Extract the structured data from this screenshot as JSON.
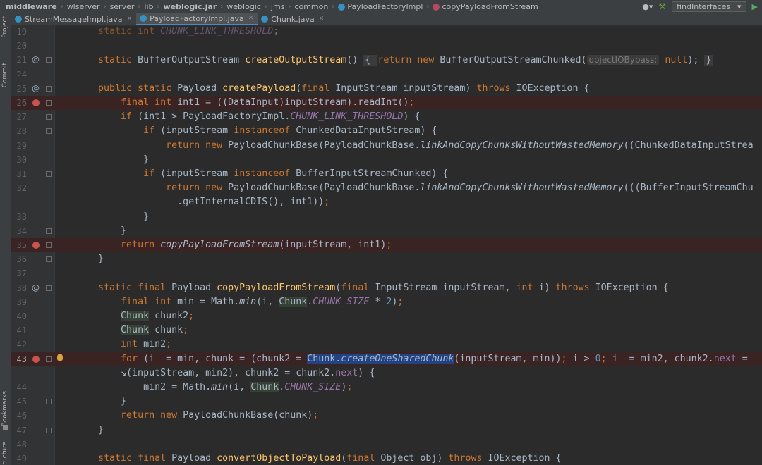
{
  "breadcrumbs": [
    {
      "label": "middleware",
      "bold": true
    },
    {
      "label": "wlserver",
      "bold": false
    },
    {
      "label": "server",
      "bold": false
    },
    {
      "label": "lib",
      "bold": false
    },
    {
      "label": "weblogic.jar",
      "bold": true
    },
    {
      "label": "weblogic",
      "bold": false
    },
    {
      "label": "jms",
      "bold": false
    },
    {
      "label": "common",
      "bold": false
    },
    {
      "label": "PayloadFactoryImpl",
      "bold": false,
      "icon": "class-c"
    },
    {
      "label": "copyPayloadFromStream",
      "bold": false,
      "icon": "method-m"
    }
  ],
  "toolbar": {
    "user_icon": "user-icon",
    "build_icon": "hammer-icon",
    "run_config_label": "findInterfaces",
    "run_icon": "run-icon"
  },
  "tabs": [
    {
      "label": "StreamMessageImpl.java",
      "active": false
    },
    {
      "label": "PayloadFactoryImpl.java",
      "active": true
    },
    {
      "label": "Chunk.java",
      "active": false
    }
  ],
  "side_tools": {
    "project": "Project",
    "commit": "Commit",
    "bookmarks": "Bookmarks",
    "structure": "Structure"
  },
  "colors": {
    "background": "#2b2b2b",
    "keyword": "#cc7832",
    "method_decl": "#ffc66d",
    "static_field": "#9876aa",
    "number": "#6897bb",
    "breakpoint": "#c75450",
    "selection": "#214283"
  },
  "lines": [
    {
      "n": "19",
      "gutter": "",
      "segments": [
        [
          "    ",
          ""
        ],
        [
          "static int ",
          "kw"
        ],
        [
          "CHUNK_LINK_THRESHOLD",
          "st"
        ],
        [
          ";",
          ""
        ]
      ],
      "faded": true
    },
    {
      "n": "20",
      "gutter": "",
      "segments": []
    },
    {
      "n": "21",
      "gutter": "@",
      "segments": [
        [
          "    ",
          ""
        ],
        [
          "static ",
          "kw"
        ],
        [
          "BufferOutputStream ",
          ""
        ],
        [
          "createOutputStream",
          "fn"
        ],
        [
          "() ",
          ""
        ],
        [
          "{ ",
          "fb"
        ],
        [
          "return new ",
          "kw"
        ],
        [
          "BufferOutputStreamChunked(",
          ""
        ],
        [
          "objectIOBypass:",
          "hint"
        ],
        [
          " ",
          ""
        ],
        [
          "null",
          "kw"
        ],
        [
          "); ",
          ""
        ],
        [
          "}",
          "fb"
        ]
      ]
    },
    {
      "n": "24",
      "gutter": "",
      "segments": []
    },
    {
      "n": "25",
      "gutter": "@",
      "segments": [
        [
          "    ",
          ""
        ],
        [
          "public static ",
          "kw"
        ],
        [
          "Payload ",
          ""
        ],
        [
          "createPayload",
          "fn"
        ],
        [
          "(",
          ""
        ],
        [
          "final ",
          "kw"
        ],
        [
          "InputStream inputStream) ",
          ""
        ],
        [
          "throws ",
          "kw"
        ],
        [
          "IOException {",
          ""
        ]
      ]
    },
    {
      "n": "26",
      "gutter": "bp",
      "segments": [
        [
          "        ",
          ""
        ],
        [
          "final int ",
          "kw"
        ],
        [
          "int1 = ((DataInput)inputStream).readInt()",
          ""
        ],
        [
          ";",
          "kw"
        ]
      ]
    },
    {
      "n": "27",
      "gutter": "",
      "segments": [
        [
          "        ",
          ""
        ],
        [
          "if ",
          "kw"
        ],
        [
          "(int1 > PayloadFactoryImpl.",
          ""
        ],
        [
          "CHUNK_LINK_THRESHOLD",
          "st"
        ],
        [
          ") {",
          ""
        ]
      ]
    },
    {
      "n": "28",
      "gutter": "",
      "segments": [
        [
          "            ",
          ""
        ],
        [
          "if ",
          "kw"
        ],
        [
          "(inputStream ",
          ""
        ],
        [
          "instanceof ",
          "kw"
        ],
        [
          "ChunkedDataInputStream) {",
          ""
        ]
      ]
    },
    {
      "n": "29",
      "gutter": "",
      "segments": [
        [
          "                ",
          ""
        ],
        [
          "return new ",
          "kw"
        ],
        [
          "PayloadChunkBase(PayloadChunkBase.",
          ""
        ],
        [
          "linkAndCopyChunksWithoutWastedMemory",
          "it"
        ],
        [
          "((ChunkedDataInputStrea",
          ""
        ]
      ]
    },
    {
      "n": "30",
      "gutter": "",
      "segments": [
        [
          "            }",
          ""
        ]
      ]
    },
    {
      "n": "31",
      "gutter": "",
      "segments": [
        [
          "            ",
          ""
        ],
        [
          "if ",
          "kw"
        ],
        [
          "(inputStream ",
          ""
        ],
        [
          "instanceof ",
          "kw"
        ],
        [
          "BufferInputStreamChunked) {",
          ""
        ]
      ]
    },
    {
      "n": "32",
      "gutter": "",
      "segments": [
        [
          "                ",
          ""
        ],
        [
          "return new ",
          "kw"
        ],
        [
          "PayloadChunkBase(PayloadChunkBase.",
          ""
        ],
        [
          "linkAndCopyChunksWithoutWastedMemory",
          "it"
        ],
        [
          "(((BufferInputStreamChu",
          ""
        ]
      ]
    },
    {
      "n": "",
      "gutter": "",
      "segments": [
        [
          "                  .getInternalCDIS(), int1))",
          ""
        ],
        [
          ";",
          "kw"
        ]
      ]
    },
    {
      "n": "33",
      "gutter": "",
      "segments": [
        [
          "            }",
          ""
        ]
      ]
    },
    {
      "n": "34",
      "gutter": "",
      "segments": [
        [
          "        }",
          ""
        ]
      ]
    },
    {
      "n": "35",
      "gutter": "bp",
      "segments": [
        [
          "        ",
          ""
        ],
        [
          "return ",
          "kw"
        ],
        [
          "copyPayloadFromStream",
          "it"
        ],
        [
          "(inputStream, int1)",
          ""
        ],
        [
          ";",
          "kw"
        ]
      ]
    },
    {
      "n": "36",
      "gutter": "",
      "segments": [
        [
          "    }",
          ""
        ]
      ]
    },
    {
      "n": "37",
      "gutter": "",
      "segments": []
    },
    {
      "n": "38",
      "gutter": "@",
      "segments": [
        [
          "    ",
          ""
        ],
        [
          "static final ",
          "kw"
        ],
        [
          "Payload ",
          ""
        ],
        [
          "copyPayloadFromStream",
          "fn"
        ],
        [
          "(",
          ""
        ],
        [
          "final ",
          "kw"
        ],
        [
          "InputStream inputStream, ",
          ""
        ],
        [
          "int ",
          "kw"
        ],
        [
          "i) ",
          ""
        ],
        [
          "throws ",
          "kw"
        ],
        [
          "IOException {",
          ""
        ]
      ]
    },
    {
      "n": "39",
      "gutter": "",
      "segments": [
        [
          "        ",
          ""
        ],
        [
          "final int ",
          "kw"
        ],
        [
          "min = Math.",
          ""
        ],
        [
          "min",
          "it"
        ],
        [
          "(i, ",
          ""
        ],
        [
          "Chunk",
          "hl"
        ],
        [
          ".",
          ""
        ],
        [
          "CHUNK_SIZE",
          "st"
        ],
        [
          " * ",
          ""
        ],
        [
          "2",
          "nm"
        ],
        [
          ")",
          ""
        ],
        [
          ";",
          "kw"
        ]
      ]
    },
    {
      "n": "40",
      "gutter": "",
      "segments": [
        [
          "        ",
          ""
        ],
        [
          "Chunk",
          "hl"
        ],
        [
          " chunk2",
          ""
        ],
        [
          ";",
          "kw"
        ]
      ]
    },
    {
      "n": "41",
      "gutter": "",
      "segments": [
        [
          "        ",
          ""
        ],
        [
          "Chunk",
          "hl"
        ],
        [
          " chunk",
          ""
        ],
        [
          ";",
          "kw"
        ]
      ]
    },
    {
      "n": "42",
      "gutter": "",
      "segments": [
        [
          "        ",
          ""
        ],
        [
          "int ",
          "kw"
        ],
        [
          "min2",
          ""
        ],
        [
          ";",
          "kw"
        ]
      ]
    },
    {
      "n": "43",
      "gutter": "bp",
      "current": true,
      "bulb": true,
      "segments": [
        [
          "        ",
          ""
        ],
        [
          "for ",
          "kw"
        ],
        [
          "(i -= min, chunk = (chunk2 = ",
          ""
        ],
        [
          "Chunk",
          "sel"
        ],
        [
          ".",
          "sel"
        ],
        [
          "createOneSharedChunk",
          "sel it"
        ],
        [
          "(inputStream, min))",
          ""
        ],
        [
          "; ",
          "kw"
        ],
        [
          "i > ",
          ""
        ],
        [
          "0",
          "nm"
        ],
        [
          "; ",
          "kw"
        ],
        [
          "i -= min2, chunk2.",
          ""
        ],
        [
          "next",
          "fd"
        ],
        [
          " =",
          ""
        ]
      ]
    },
    {
      "n": "",
      "gutter": "",
      "segments": [
        [
          "        ↘(inputStream, min2), chunk2 = chunk2.",
          ""
        ],
        [
          "next",
          "fd"
        ],
        [
          ") {",
          ""
        ]
      ]
    },
    {
      "n": "44",
      "gutter": "",
      "segments": [
        [
          "            min2 = Math.",
          ""
        ],
        [
          "min",
          "it"
        ],
        [
          "(i, ",
          ""
        ],
        [
          "Chunk",
          "hl"
        ],
        [
          ".",
          ""
        ],
        [
          "CHUNK_SIZE",
          "st"
        ],
        [
          ")",
          ""
        ],
        [
          ";",
          "kw"
        ]
      ]
    },
    {
      "n": "45",
      "gutter": "",
      "segments": [
        [
          "        }",
          ""
        ]
      ]
    },
    {
      "n": "46",
      "gutter": "",
      "segments": [
        [
          "        ",
          ""
        ],
        [
          "return new ",
          "kw"
        ],
        [
          "PayloadChunkBase(chunk)",
          ""
        ],
        [
          ";",
          "kw"
        ]
      ]
    },
    {
      "n": "47",
      "gutter": "",
      "segments": [
        [
          "    }",
          ""
        ]
      ]
    },
    {
      "n": "48",
      "gutter": "",
      "segments": []
    },
    {
      "n": "49",
      "gutter": "",
      "segments": [
        [
          "    ",
          ""
        ],
        [
          "static final ",
          "kw"
        ],
        [
          "Payload ",
          ""
        ],
        [
          "convertObjectToPayload",
          "fn"
        ],
        [
          "(",
          ""
        ],
        [
          "final ",
          "kw"
        ],
        [
          "Object obj) ",
          ""
        ],
        [
          "throws ",
          "kw"
        ],
        [
          "IOException {",
          ""
        ]
      ]
    }
  ]
}
